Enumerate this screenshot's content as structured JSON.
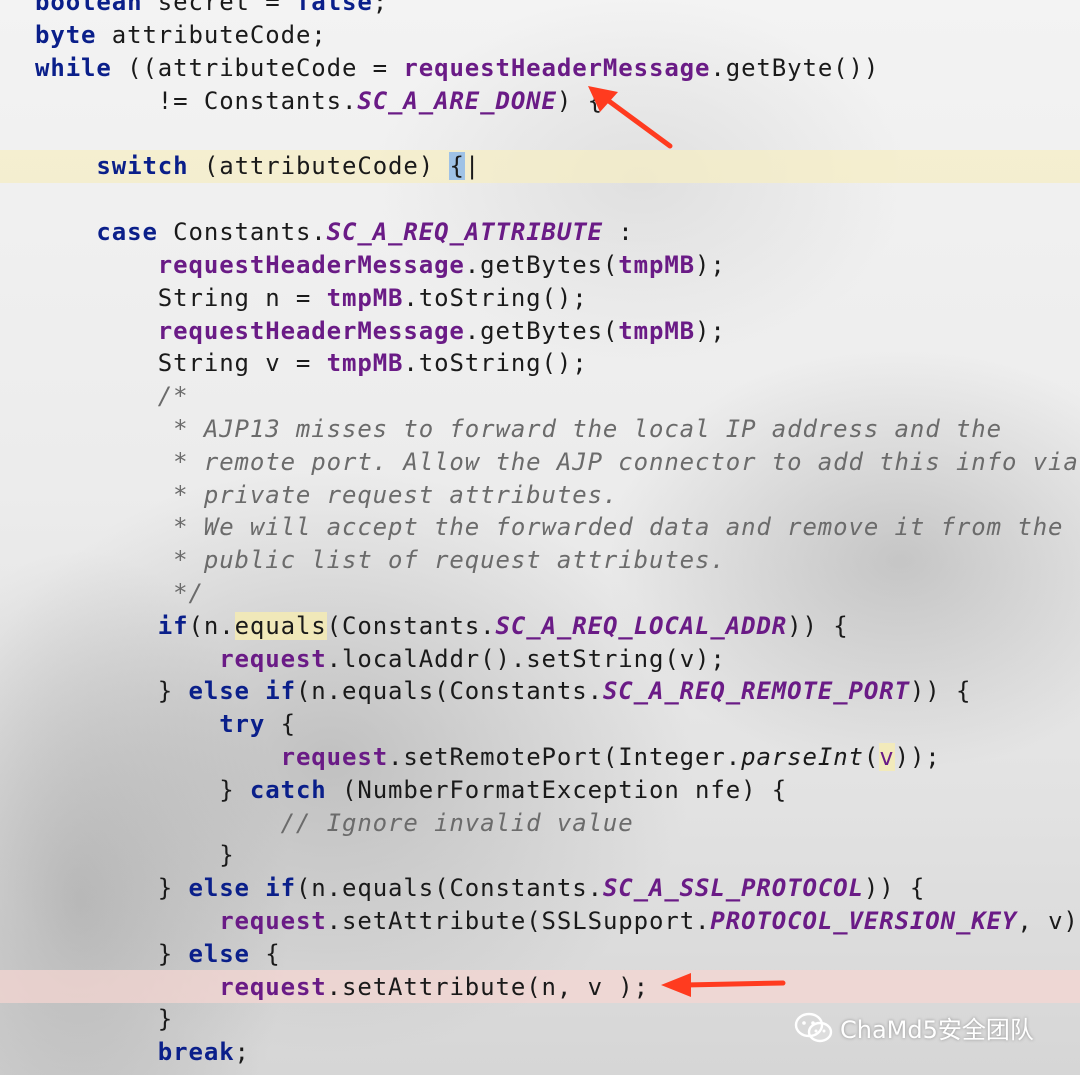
{
  "editor": {
    "lines": [
      [
        "boolean secret = false;"
      ],
      [
        "byte attributeCode;"
      ],
      [
        "while ((attributeCode = requestHeaderMessage.getByte())"
      ],
      [
        "        != Constants.SC_A_ARE_DONE) {"
      ],
      [
        ""
      ],
      [
        "    switch (attributeCode) {"
      ],
      [
        ""
      ],
      [
        "    case Constants.SC_A_REQ_ATTRIBUTE :"
      ],
      [
        "        requestHeaderMessage.getBytes(tmpMB);"
      ],
      [
        "        String n = tmpMB.toString();"
      ],
      [
        "        requestHeaderMessage.getBytes(tmpMB);"
      ],
      [
        "        String v = tmpMB.toString();"
      ],
      [
        "        /*"
      ],
      [
        "         * AJP13 misses to forward the local IP address and the"
      ],
      [
        "         * remote port. Allow the AJP connector to add this info via"
      ],
      [
        "         * private request attributes."
      ],
      [
        "         * We will accept the forwarded data and remove it from the"
      ],
      [
        "         * public list of request attributes."
      ],
      [
        "         */"
      ],
      [
        "        if(n.equals(Constants.SC_A_REQ_LOCAL_ADDR)) {"
      ],
      [
        "            request.localAddr().setString(v);"
      ],
      [
        "        } else if(n.equals(Constants.SC_A_REQ_REMOTE_PORT)) {"
      ],
      [
        "            try {"
      ],
      [
        "                request.setRemotePort(Integer.parseInt(v));"
      ],
      [
        "            } catch (NumberFormatException nfe) {"
      ],
      [
        "                // Ignore invalid value"
      ],
      [
        "            }"
      ],
      [
        "        } else if(n.equals(Constants.SC_A_SSL_PROTOCOL)) {"
      ],
      [
        "            request.setAttribute(SSLSupport.PROTOCOL_VERSION_KEY, v);"
      ],
      [
        "        } else {"
      ],
      [
        "            request.setAttribute(n, v );"
      ],
      [
        "        }"
      ],
      [
        "        break;"
      ]
    ],
    "highlighted_lines": {
      "caret_line": 6,
      "marked_line": 31
    }
  },
  "annotations": {
    "arrow_color": "#ff3b1f",
    "arrows": [
      "arrow-to-SC_A_ARE_DONE",
      "arrow-to-setAttribute"
    ]
  },
  "watermark": {
    "icon": "wechat-icon",
    "text": "ChaMd5安全团队"
  },
  "colors": {
    "keyword": "#0a1f8a",
    "field": "#6a1b86",
    "comment": "#6b6b6b",
    "caret_line_bg": "#f5ebb4",
    "marked_line_bg": "#f3d6d3"
  }
}
